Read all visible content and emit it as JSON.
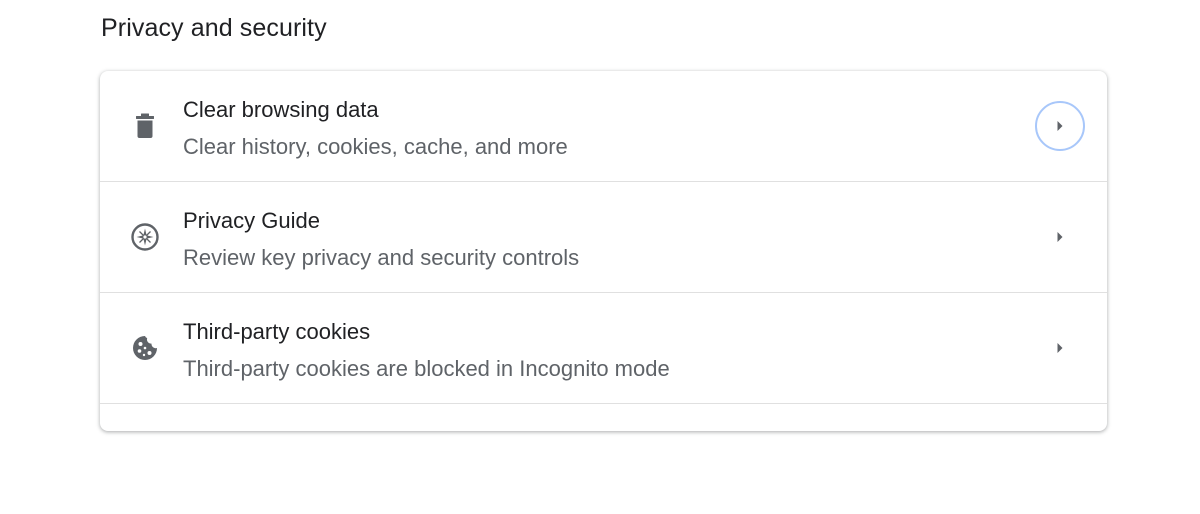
{
  "section": {
    "title": "Privacy and security"
  },
  "items": [
    {
      "title": "Clear browsing data",
      "subtitle": "Clear history, cookies, cache, and more",
      "icon": "trash-icon"
    },
    {
      "title": "Privacy Guide",
      "subtitle": "Review key privacy and security controls",
      "icon": "compass-icon"
    },
    {
      "title": "Third-party cookies",
      "subtitle": "Third-party cookies are blocked in Incognito mode",
      "icon": "cookie-icon"
    }
  ],
  "colors": {
    "text_primary": "#202124",
    "text_secondary": "#5f6368",
    "icon": "#5f6368",
    "focus_ring": "#a8c7fa"
  }
}
